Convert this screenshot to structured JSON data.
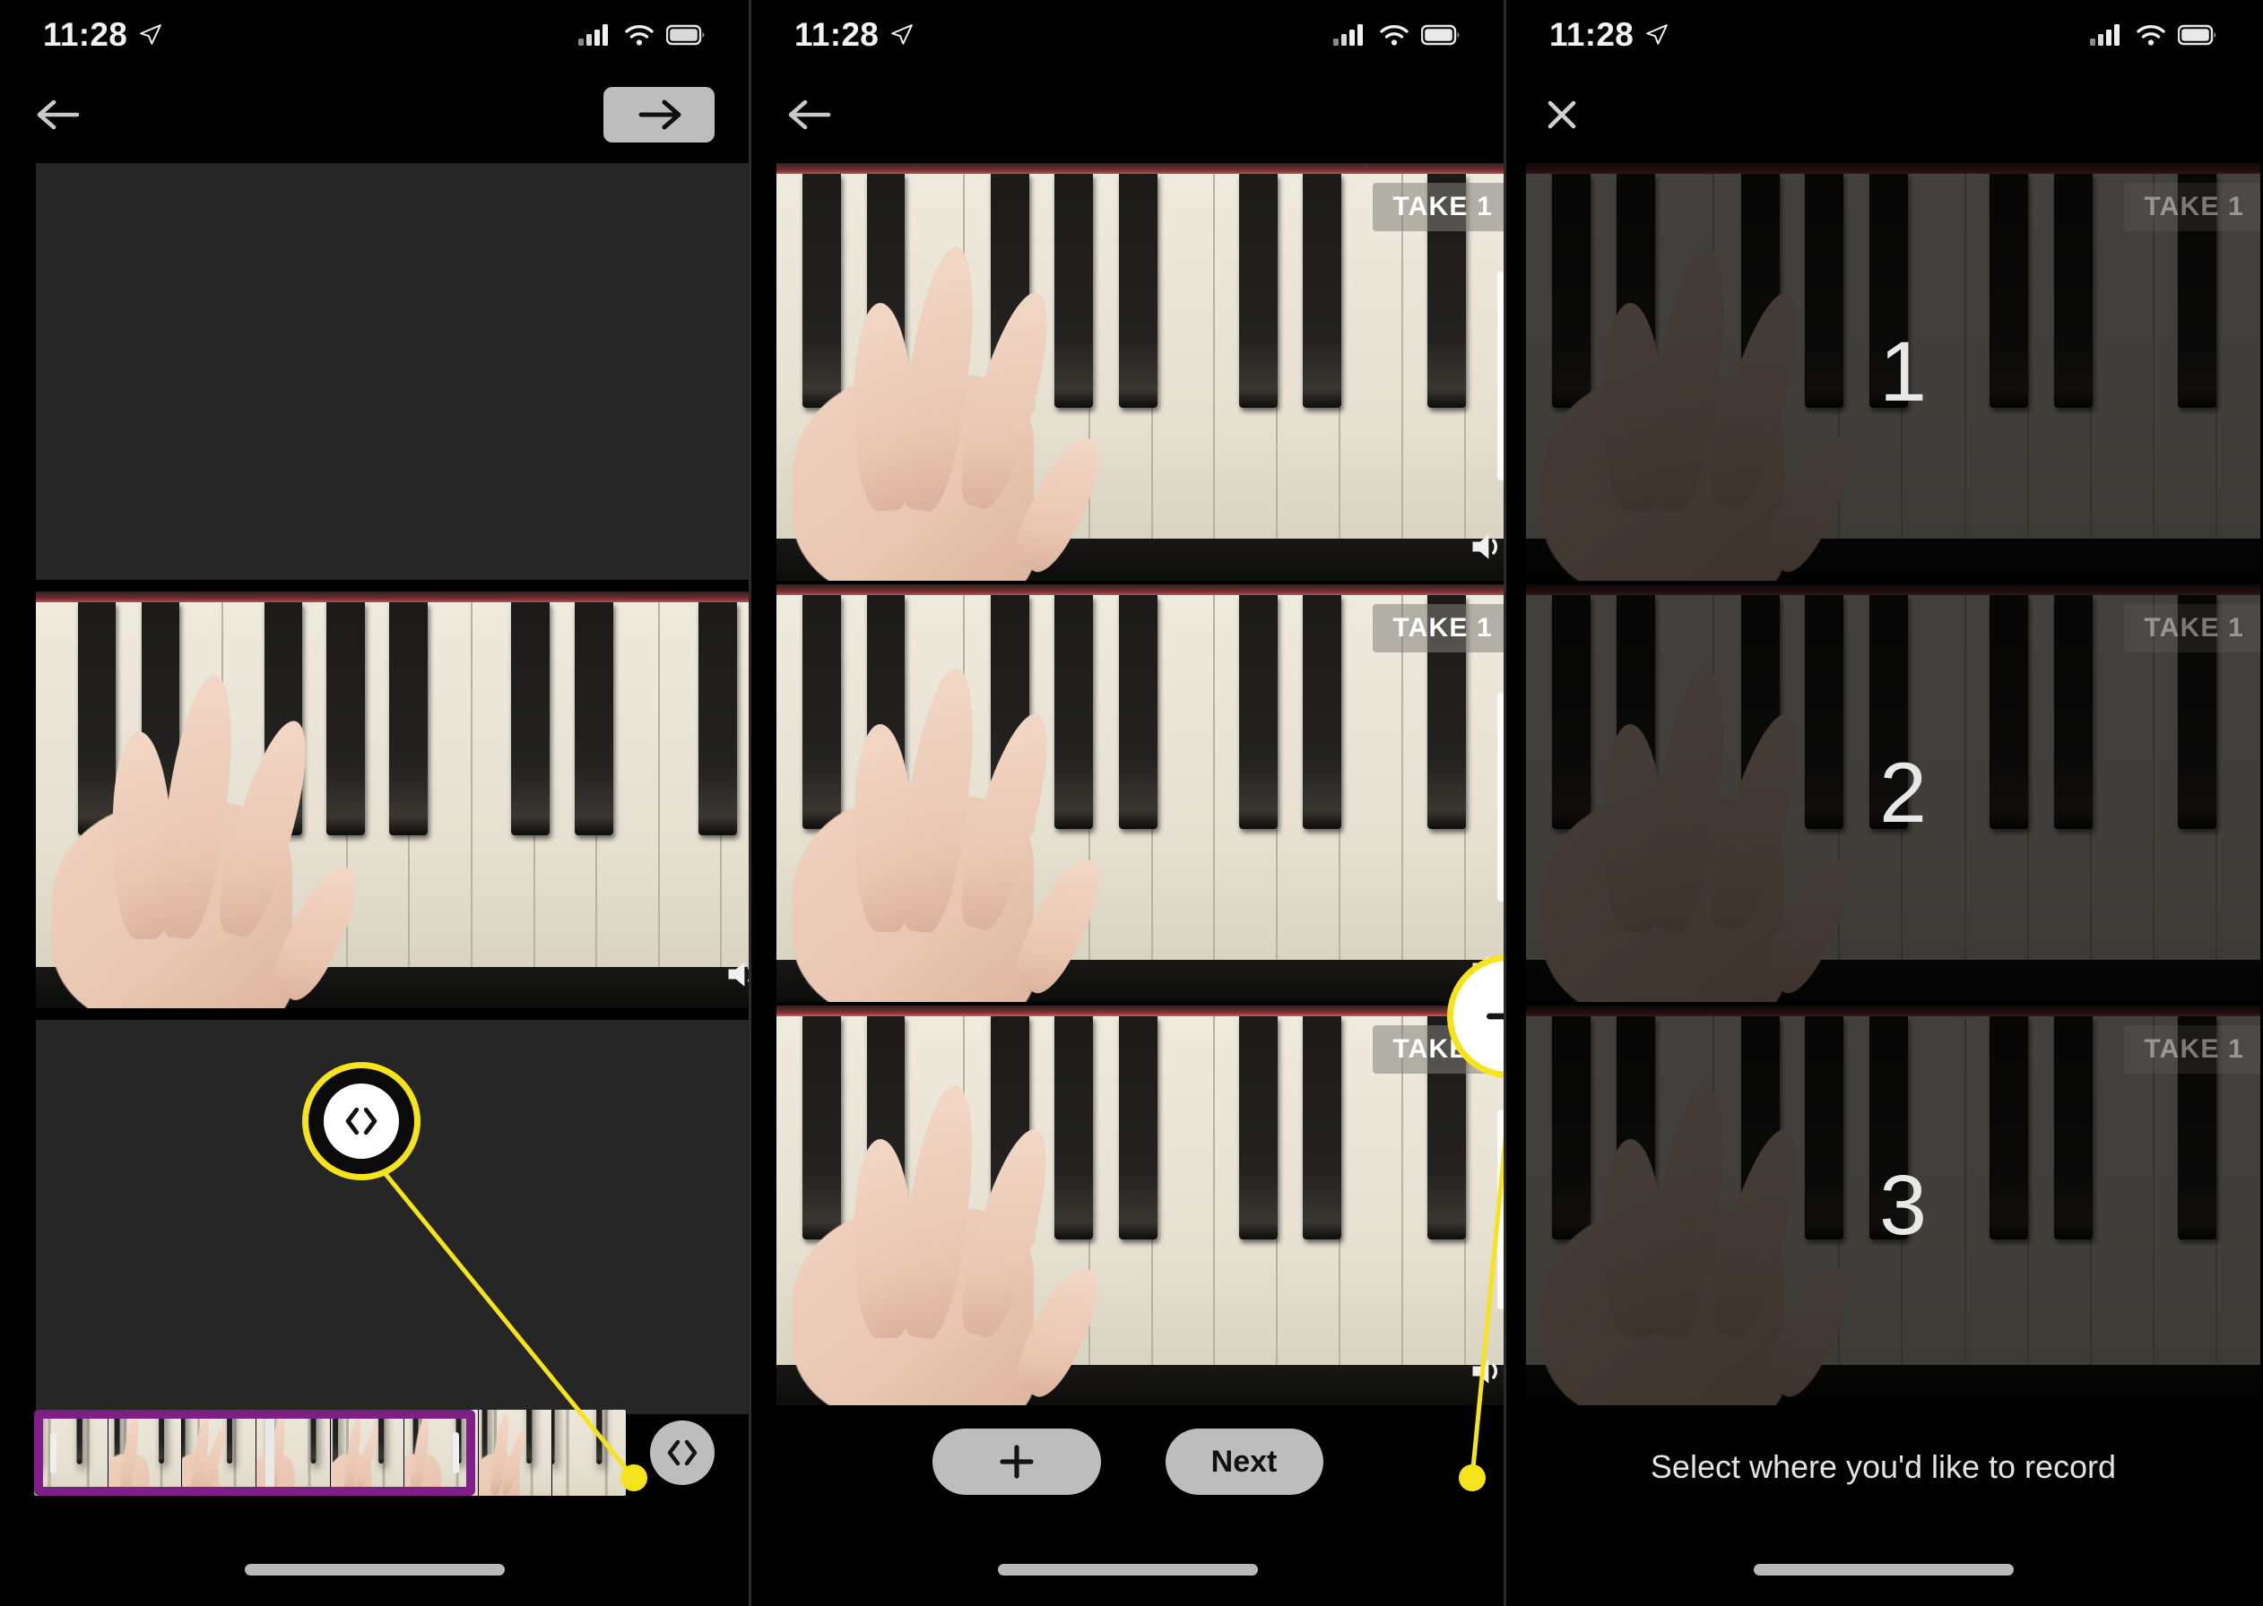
{
  "status_bar": {
    "time": "11:28",
    "icons": [
      "location-arrow-icon",
      "cellular-signal-icon",
      "wifi-icon",
      "battery-icon"
    ]
  },
  "panels": [
    {
      "id": "edit-clip-screen",
      "nav": {
        "back_icon": "arrow-left-icon",
        "forward_label": "arrow-right-icon"
      },
      "tiles": [
        {
          "type": "placeholder",
          "take_label": "",
          "has_video": false
        },
        {
          "type": "video",
          "take_label": "",
          "has_video": true,
          "sound_icon": "speaker-icon"
        },
        {
          "type": "placeholder",
          "take_label": "",
          "has_video": false
        }
      ],
      "timeline": {
        "trim_button_icon": "trim-brackets-icon",
        "frames": 8
      },
      "callout": {
        "icon": "trim-brackets-icon",
        "style": "dark-circle-yellow-ring"
      }
    },
    {
      "id": "takes-list-screen",
      "nav": {
        "back_icon": "arrow-left-icon"
      },
      "tiles": [
        {
          "type": "video",
          "take_label": "TAKE 1",
          "has_video": true,
          "sound_icon": "speaker-icon"
        },
        {
          "type": "video",
          "take_label": "TAKE 1",
          "has_video": true,
          "sound_icon": "speaker-icon"
        },
        {
          "type": "video",
          "take_label": "TAKE 1",
          "has_video": true,
          "sound_icon": "speaker-icon"
        }
      ],
      "bottom_bar": {
        "add_label": "+",
        "add_icon": "plus-icon",
        "next_label": "Next"
      },
      "callout": {
        "icon": "plus-icon",
        "style": "white-circle-yellow-ring"
      }
    },
    {
      "id": "select-slot-screen",
      "nav": {
        "close_icon": "close-x-icon"
      },
      "tiles": [
        {
          "type": "video-dimmed",
          "take_label": "TAKE 1",
          "number": "1"
        },
        {
          "type": "video-dimmed",
          "take_label": "TAKE 1",
          "number": "2"
        },
        {
          "type": "video-dimmed",
          "take_label": "TAKE 1",
          "number": "3"
        }
      ],
      "caption": "Select where you'd like to record"
    }
  ],
  "colors": {
    "background": "#000000",
    "placeholder": "#262626",
    "button_gray": "#bdbdbd",
    "callout_yellow": "#f5e31b",
    "trim_purple": "#7d1f86",
    "text_light": "#e3e3e3"
  }
}
